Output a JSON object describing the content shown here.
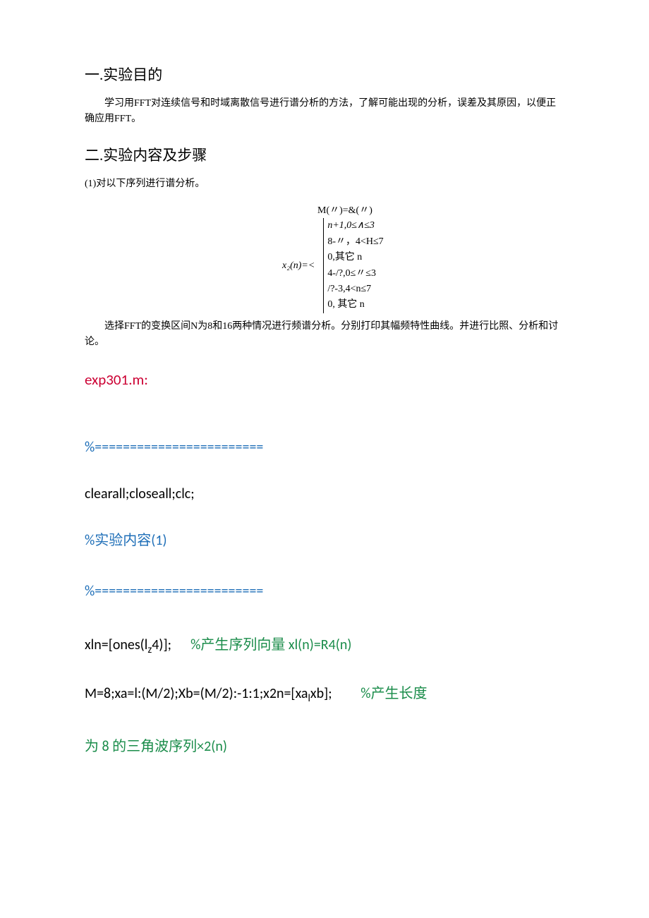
{
  "section1": {
    "heading": "一.实验目的",
    "body": "学习用FFT对连续信号和时域离散信号进行谱分析的方法，了解可能出现的分析，误差及其原因，以便正确应用FFT。"
  },
  "section2": {
    "heading": "二.实验内容及步骤",
    "sub1": "(1)对以下序列进行谱分析。"
  },
  "math": {
    "line1_left": "M(〃)=&(〃)",
    "eq2_lhs": "x₂(n)=<",
    "eq2_r1": "n+1,0≤∧≤3",
    "eq2_r2": "8-〃，4<H≤7",
    "eq2_r3": "0,其它 n",
    "eq3_r1": "4-/?,0≤〃≤3",
    "eq3_r2": "/?-3,4<n≤7",
    "eq3_r3": "0,     其它 n"
  },
  "aftermath": "选择FFT的变换区间N为8和16两种情况进行频谱分析。分别打印其幅频特性曲线。并进行比照、分析和讨论。",
  "code": {
    "filename": "exp301.m:",
    "sep1": "%========================",
    "clear": "clearall;closeall;clc;",
    "comment1": "%实验内容(1)",
    "sep2": "%========================",
    "line_xln_a": "xln=[ones(l",
    "line_xln_sub": "z",
    "line_xln_b": "4)];",
    "line_xln_comment": "%产生序列向量 xl(n)=R4(n)",
    "line_m_a": "M=8;xa=l:(M/2);Xb=(M/2):-1:1;x2n=[xa",
    "line_m_sub": "l",
    "line_m_b": "xb];",
    "line_m_comment": "%产生长度",
    "line_tail": "为 8 的三角波序列×2(n)"
  }
}
